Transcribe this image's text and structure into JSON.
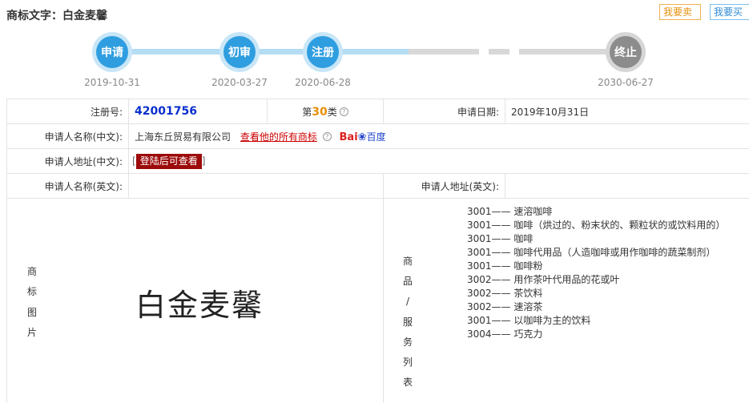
{
  "header": {
    "title": "商标文字：白金麦馨",
    "sell_label": "我要卖",
    "buy_label": "我要买"
  },
  "timeline": [
    {
      "label": "申请",
      "date": "2019-10-31",
      "state": "done"
    },
    {
      "label": "初审",
      "date": "2020-03-27",
      "state": "done"
    },
    {
      "label": "注册",
      "date": "2020-06-28",
      "state": "done"
    },
    {
      "label": "终止",
      "date": "2030-06-27",
      "state": "pending"
    }
  ],
  "details": {
    "reg_no_label": "注册号:",
    "reg_no": "42001756",
    "class_prefix": "第",
    "class_num": "30",
    "class_suffix": "类",
    "apply_date_label": "申请日期:",
    "apply_date": "2019年10月31日",
    "applicant_cn_label": "申请人名称(中文):",
    "applicant_cn": "上海东丘贸易有限公司",
    "view_all_link": "查看他的所有商标",
    "baidu_text": "Bai",
    "baidu_text2": "百度",
    "address_cn_label": "申请人地址(中文):",
    "login_btn": "登陆后可查看",
    "applicant_en_label": "申请人名称(英文):",
    "address_en_label": "申请人地址(英文):",
    "image_label_chars": [
      "商",
      "标",
      "图",
      "片"
    ],
    "trademark_word": "白金麦馨",
    "goods_label_chars": [
      "商",
      "品",
      "/",
      "服",
      "务",
      "列",
      "表"
    ]
  },
  "goods": [
    {
      "code": "3001——",
      "name": "速溶咖啡"
    },
    {
      "code": "3001——",
      "name": "咖啡（烘过的、粉末状的、颗粒状的或饮料用的）"
    },
    {
      "code": "3001——",
      "name": "咖啡"
    },
    {
      "code": "3001——",
      "name": "咖啡代用品（人造咖啡或用作咖啡的蔬菜制剂）"
    },
    {
      "code": "3001——",
      "name": "咖啡粉"
    },
    {
      "code": "3002——",
      "name": "用作茶叶代用品的花或叶"
    },
    {
      "code": "3002——",
      "name": "茶饮料"
    },
    {
      "code": "3002——",
      "name": "速溶茶"
    },
    {
      "code": "3001——",
      "name": "以咖啡为主的饮料"
    },
    {
      "code": "3004——",
      "name": "巧克力"
    }
  ],
  "colors": {
    "accent_blue": "#2f9ee0",
    "accent_orange": "#e8900c",
    "link_red": "#cc0000",
    "login_red": "#9c0a0a",
    "reg_blue": "#0a2fcc"
  }
}
